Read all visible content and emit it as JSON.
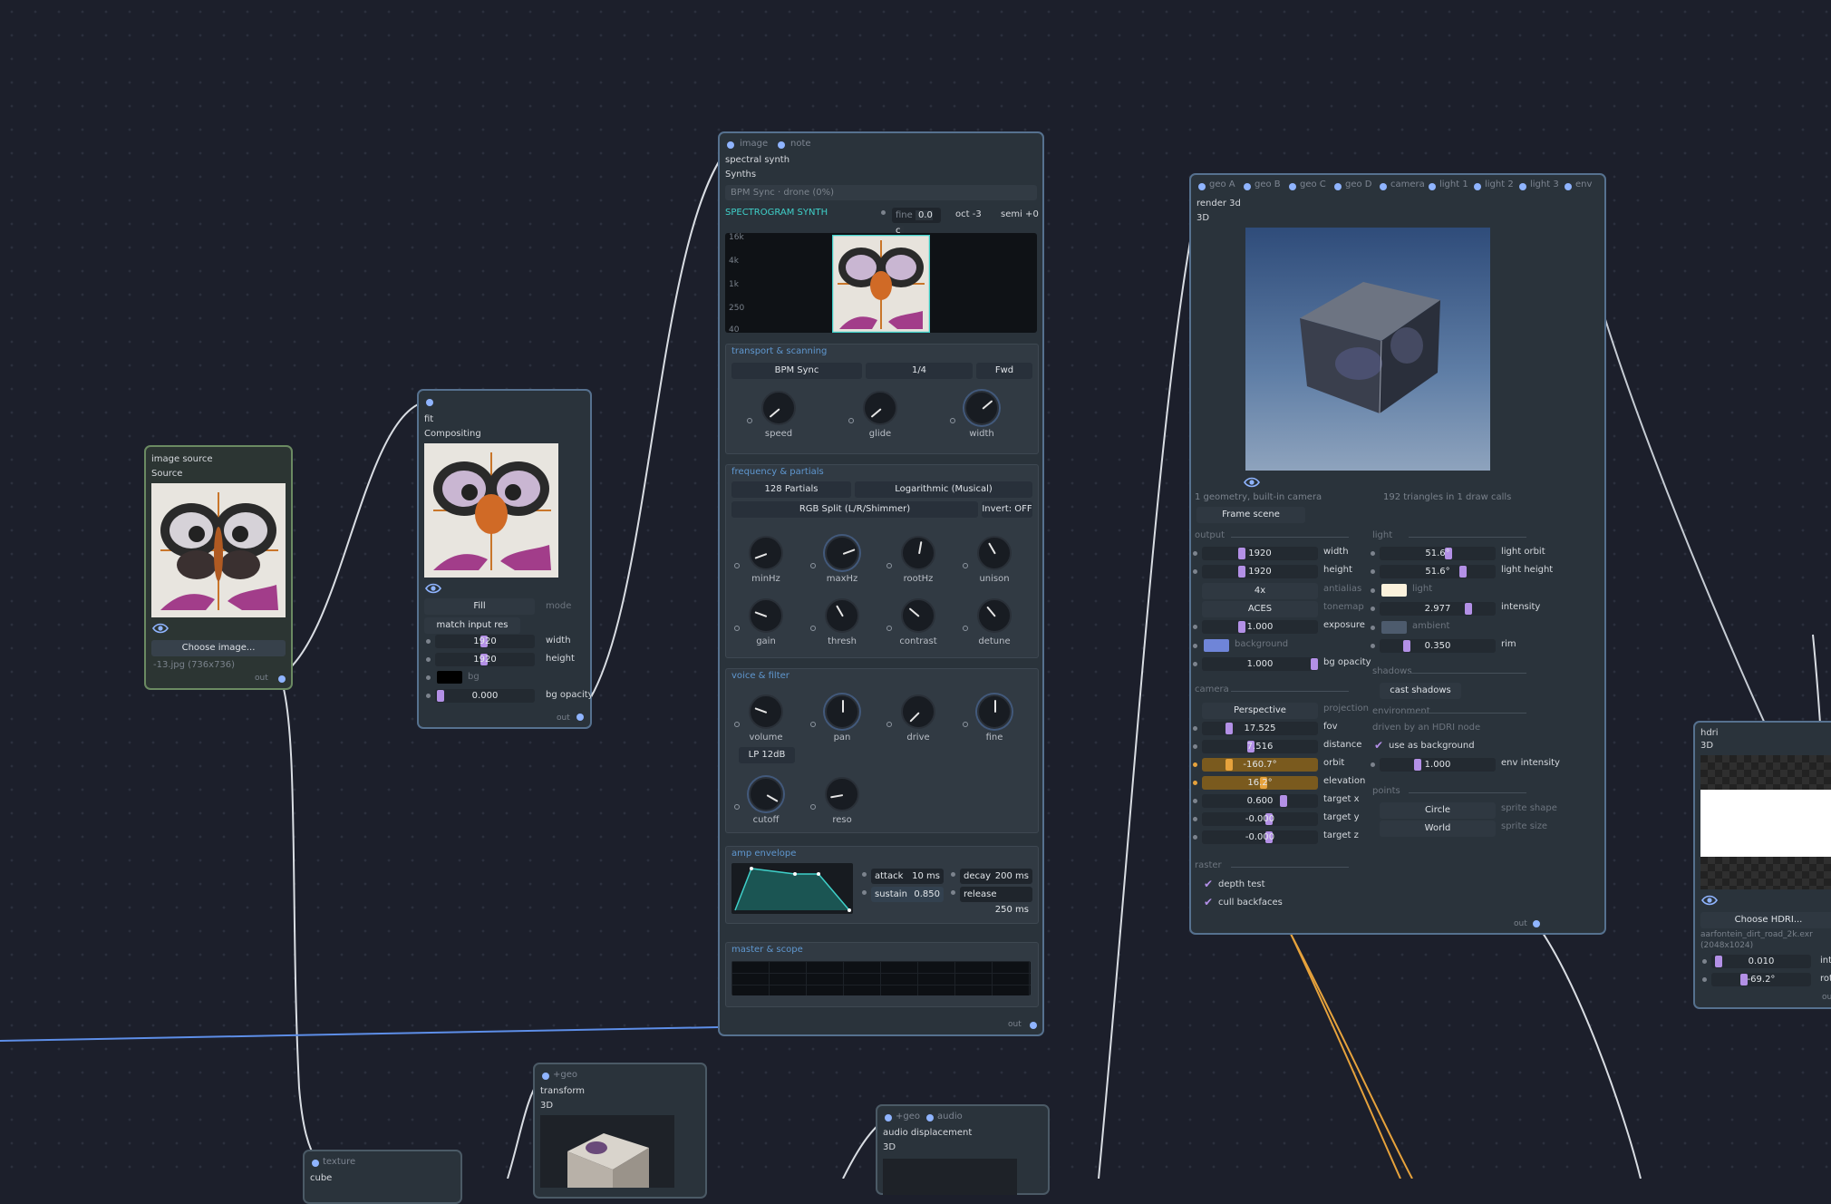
{
  "app": {
    "accent": "#8fb4ff",
    "wire_colors": {
      "white": "#d9dde3",
      "blue": "#5d8ee8",
      "orange": "#e6a23c"
    }
  },
  "image_source": {
    "title": "image source",
    "subtitle": "Source",
    "choose_label": "Choose image...",
    "file_info": "-13.jpg (736x736)",
    "out_label": "out"
  },
  "fit": {
    "title": "fit",
    "subtitle": "Compositing",
    "mode_value": "Fill",
    "mode_label": "mode",
    "match_label": "match input res",
    "width_value": "1920",
    "width_label": "width",
    "height_value": "1920",
    "height_label": "height",
    "bg_label": "bg",
    "bg_opacity_value": "0.000",
    "bg_opacity_label": "bg opacity",
    "out_label": "out"
  },
  "synth": {
    "port_image": "image",
    "port_note": "note",
    "title": "spectral synth",
    "subtitle": "Synths",
    "bpm_banner": "BPM Sync · drone (0%)",
    "header": "SPECTROGRAM SYNTH",
    "fine_label": "fine",
    "fine_value": "0.0 c",
    "oct_label": "oct -3",
    "semi_label": "semi +0",
    "freq_ticks": [
      "16k",
      "4k",
      "1k",
      "250",
      "40"
    ],
    "transport": {
      "head": "transport & scanning",
      "mode": "BPM Sync",
      "division": "1/4",
      "direction": "Fwd",
      "knobs": [
        {
          "label": "speed"
        },
        {
          "label": "glide"
        },
        {
          "label": "width"
        }
      ]
    },
    "frequency": {
      "head": "frequency & partials",
      "partials": "128 Partials",
      "scale": "Logarithmic (Musical)",
      "split": "RGB Split (L/R/Shimmer)",
      "invert": "Invert: OFF",
      "knobs_row1": [
        "minHz",
        "maxHz",
        "rootHz",
        "unison"
      ],
      "knobs_row2": [
        "gain",
        "thresh",
        "contrast",
        "detune"
      ]
    },
    "voice": {
      "head": "voice & filter",
      "knobs": [
        "volume",
        "pan",
        "drive",
        "fine"
      ],
      "filter_type": "LP 12dB",
      "knobs2": [
        "cutoff",
        "reso"
      ]
    },
    "amp": {
      "head": "amp envelope",
      "attack_label": "attack",
      "attack_value": "10 ms",
      "decay_label": "decay",
      "decay_value": "200 ms",
      "sustain_label": "sustain",
      "sustain_value": "0.850",
      "release_label": "release",
      "release_value": "250 ms"
    },
    "master": {
      "head": "master & scope"
    },
    "out_label": "out"
  },
  "render3d": {
    "ports": [
      "geo A",
      "geo B",
      "geo C",
      "geo D",
      "camera",
      "light 1",
      "light 2",
      "light 3",
      "env"
    ],
    "title": "render 3d",
    "subtitle": "3D",
    "info_left": "1 geometry, built-in camera",
    "info_right": "192 triangles in 1 draw calls",
    "frame_button": "Frame scene",
    "output": {
      "head": "output",
      "width_value": "1920",
      "width_label": "width",
      "height_value": "1920",
      "height_label": "height",
      "aa_value": "4x",
      "aa_label": "antialias",
      "tone_value": "ACES",
      "tone_label": "tonemap",
      "exposure_value": "1.000",
      "exposure_label": "exposure",
      "background_label": "background",
      "bgop_value": "1.000",
      "bgop_label": "bg opacity"
    },
    "camera": {
      "head": "camera",
      "proj_value": "Perspective",
      "proj_label": "projection",
      "fov_value": "17.525",
      "fov_label": "fov",
      "dist_value": "7.516",
      "dist_label": "distance",
      "orbit_value": "-160.7°",
      "orbit_label": "orbit",
      "elev_value": "16.2°",
      "elev_label": "elevation",
      "tx_value": "0.600",
      "tx_label": "target x",
      "ty_value": "-0.000",
      "ty_label": "target y",
      "tz_value": "-0.000",
      "tz_label": "target z"
    },
    "raster": {
      "head": "raster",
      "depth_label": "depth test",
      "cull_label": "cull backfaces"
    },
    "light": {
      "head": "light",
      "orbit_value": "51.6°",
      "orbit_label": "light orbit",
      "height_value": "51.6°",
      "height_label": "light height",
      "color_label": "light",
      "intensity_value": "2.977",
      "intensity_label": "intensity",
      "ambient_label": "ambient",
      "rim_value": "0.350",
      "rim_label": "rim"
    },
    "shadows": {
      "head": "shadows",
      "cast_label": "cast shadows"
    },
    "environment": {
      "head": "environment",
      "note": "driven by an HDRI node",
      "use_bg_label": "use as background",
      "intensity_value": "1.000",
      "intensity_label": "env intensity"
    },
    "points": {
      "head": "points",
      "shape_value": "Circle",
      "shape_label": "sprite shape",
      "size_value": "World",
      "size_label": "sprite size"
    },
    "out_label": "out"
  },
  "hdri": {
    "title": "hdri",
    "subtitle": "3D",
    "choose_label": "Choose HDRI...",
    "file_info": "aarfontein_dirt_road_2k.exr",
    "res_info": "(2048x1024)",
    "v1_value": "0.010",
    "v1_label": "inte",
    "v2_value": "-69.2°",
    "v2_label": "rot",
    "out_label": "out"
  },
  "transform": {
    "port": "+geo",
    "title": "transform",
    "subtitle": "3D"
  },
  "audio_disp": {
    "port_geo": "+geo",
    "port_audio": "audio",
    "title": "audio displacement",
    "subtitle": "3D"
  },
  "cube": {
    "port": "texture",
    "title": "cube"
  }
}
